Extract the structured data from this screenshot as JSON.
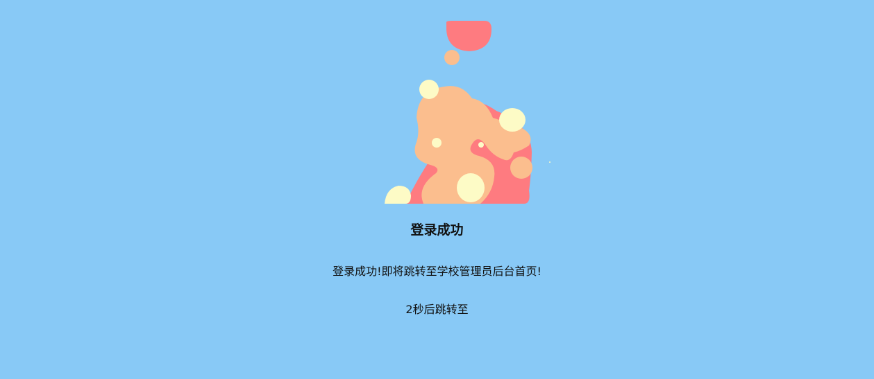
{
  "status": {
    "title": "登录成功",
    "message": "登录成功!即将跳转至学校管理员后台首页!",
    "countdown": "2",
    "countdown_suffix": "秒后跳转至",
    "redirect_link_text": ""
  },
  "illustration": {
    "icon": "blob-illustration-icon",
    "colors": {
      "background": "#88c9f6",
      "pink": "#fe7b80",
      "peach": "#fbbe8e",
      "cream": "#fdfbc6"
    }
  }
}
